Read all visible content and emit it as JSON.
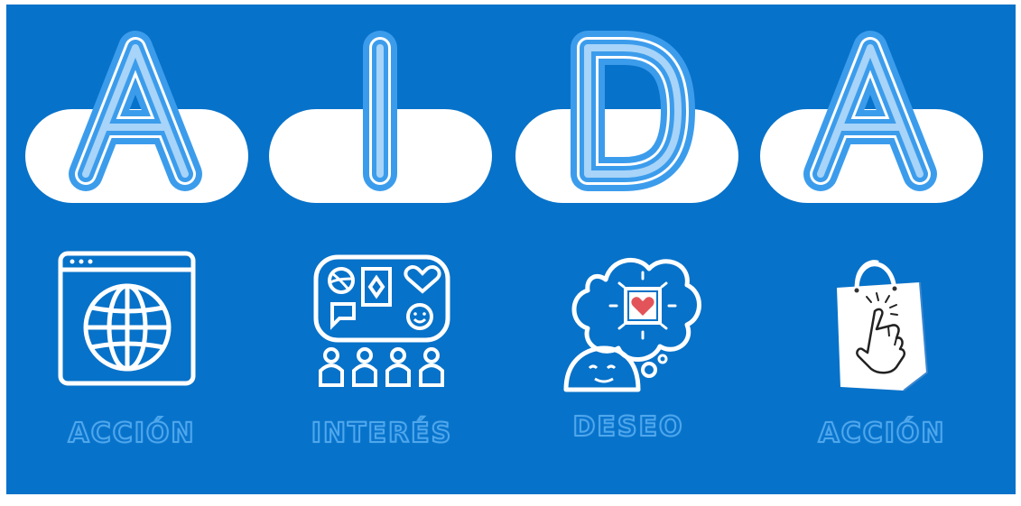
{
  "letters": [
    "A",
    "I",
    "D",
    "A"
  ],
  "labels": [
    "ACCIÓN",
    "INTERÉS",
    "DESEO",
    "ACCIÓN"
  ],
  "icons": [
    "browser-globe-icon",
    "interests-board-icon",
    "thought-heart-icon",
    "shopping-bag-tap-icon"
  ],
  "colors": {
    "background": "#0772c9",
    "pill": "#ffffff",
    "letter_outline": "#3c9cec",
    "letter_fill": "#9fd0f7",
    "label": "#4fa7ec",
    "heart": "#e2545a"
  }
}
